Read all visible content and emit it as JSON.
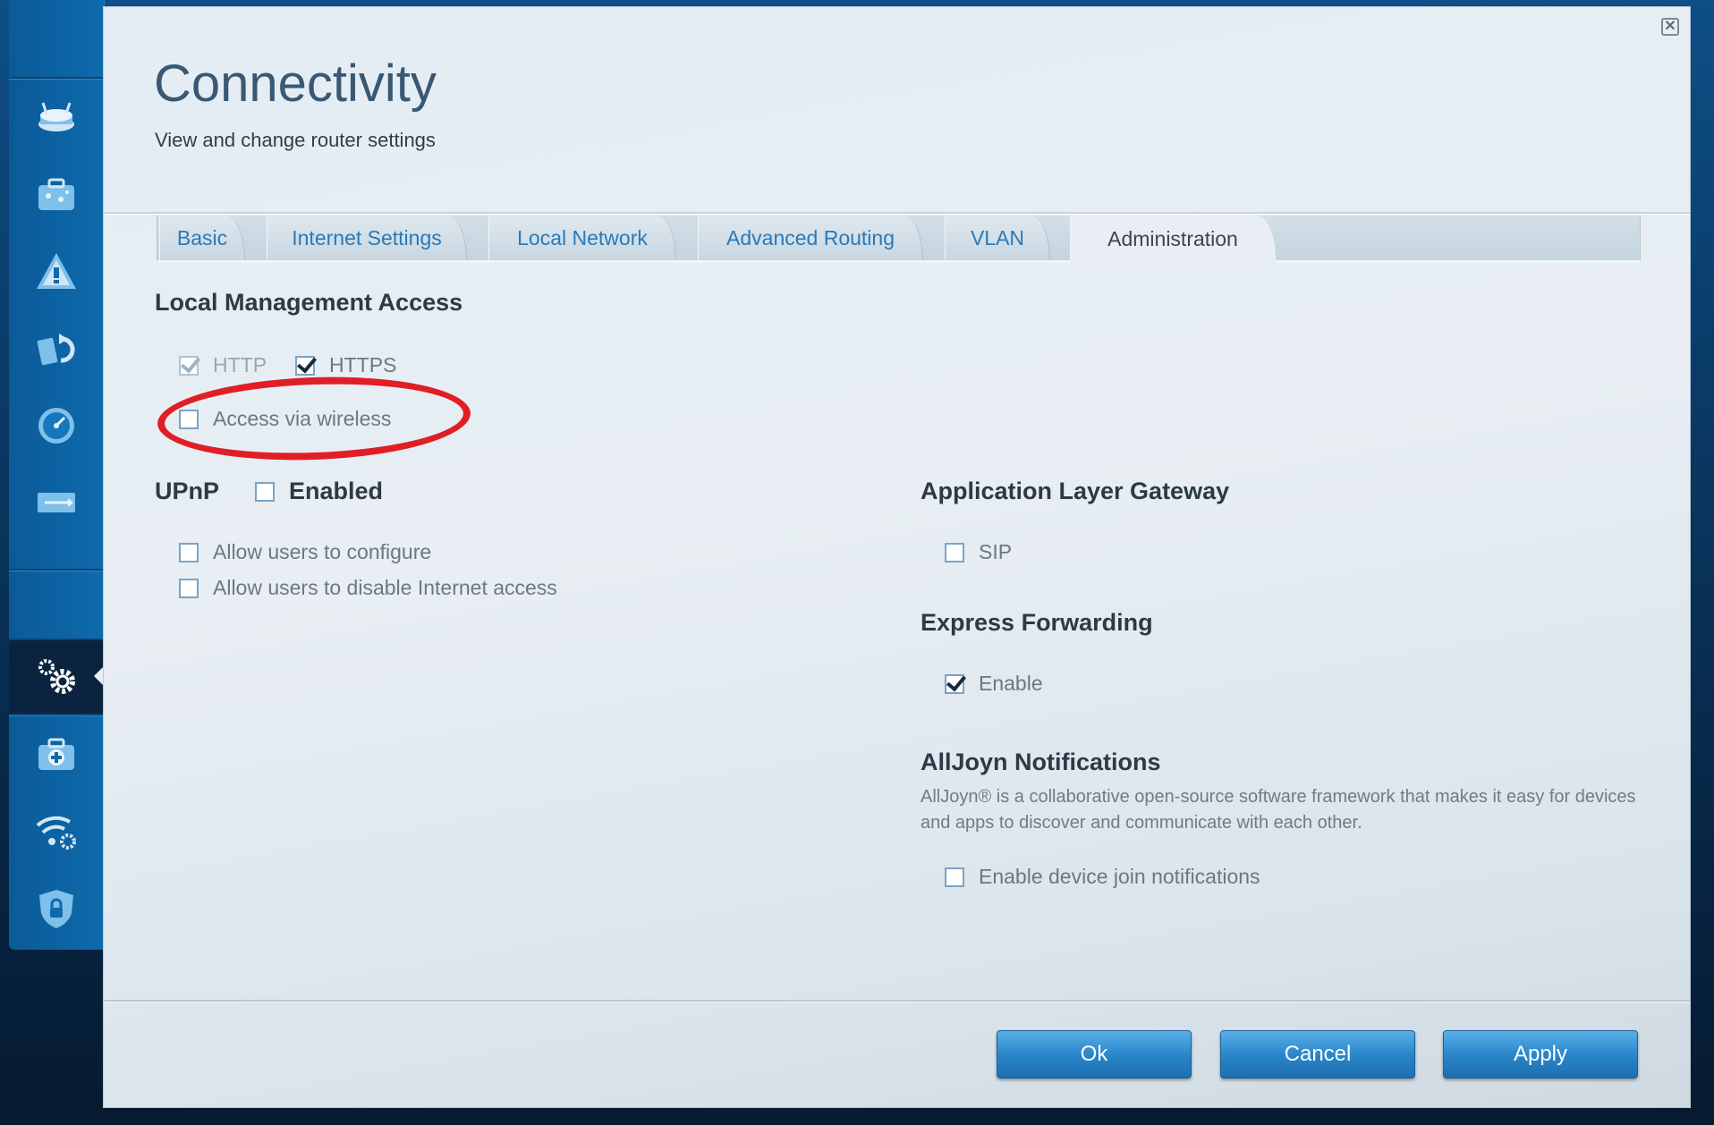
{
  "sidebar": {
    "items": [
      {
        "icon": "router-icon"
      },
      {
        "icon": "device-list-icon"
      },
      {
        "icon": "troubleshooting-icon"
      },
      {
        "icon": "firmware-update-icon"
      },
      {
        "icon": "speed-test-icon"
      },
      {
        "icon": "usb-storage-icon"
      },
      {
        "icon": "connectivity-gears-icon",
        "active": true
      },
      {
        "icon": "troubleshoot-kit-icon"
      },
      {
        "icon": "wireless-settings-icon"
      },
      {
        "icon": "security-shield-icon"
      }
    ]
  },
  "dialog": {
    "title": "Connectivity",
    "subtitle": "View and change router settings",
    "close_label": "✕"
  },
  "tabs": [
    {
      "label": "Basic"
    },
    {
      "label": "Internet Settings"
    },
    {
      "label": "Local Network"
    },
    {
      "label": "Advanced Routing"
    },
    {
      "label": "VLAN"
    },
    {
      "label": "Administration",
      "active": true
    }
  ],
  "local_management": {
    "title": "Local Management Access",
    "http_label": "HTTP",
    "http_checked": true,
    "http_disabled": true,
    "https_label": "HTTPS",
    "https_checked": true,
    "wireless_label": "Access via wireless",
    "wireless_checked": false
  },
  "upnp": {
    "title": "UPnP",
    "enabled_label": "Enabled",
    "enabled_checked": false,
    "allow_configure_label": "Allow users to configure",
    "allow_disable_label": "Allow users to disable Internet access"
  },
  "alg": {
    "title": "Application Layer Gateway",
    "sip_label": "SIP",
    "sip_checked": false
  },
  "express_forwarding": {
    "title": "Express Forwarding",
    "enable_label": "Enable",
    "enable_checked": true
  },
  "alljoyn": {
    "title": "AllJoyn Notifications",
    "description": "AllJoyn® is a collaborative open-source software framework that makes it easy for devices and apps to discover and communicate with each other.",
    "notify_label": "Enable device join notifications",
    "notify_checked": false
  },
  "footer": {
    "ok_label": "Ok",
    "cancel_label": "Cancel",
    "apply_label": "Apply"
  },
  "colors": {
    "accent_blue": "#2a7ab8",
    "highlight_red": "#e01e26",
    "button_blue": "#2a86cb"
  }
}
